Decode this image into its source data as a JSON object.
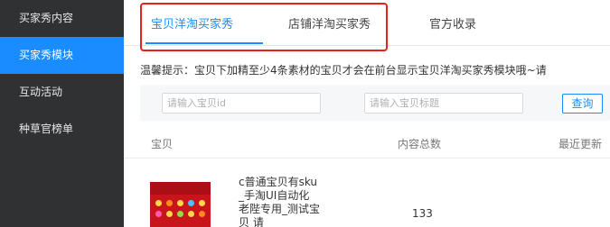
{
  "sidebar": {
    "items": [
      {
        "label": "买家秀内容",
        "active": false
      },
      {
        "label": "买家秀模块",
        "active": true
      },
      {
        "label": "互动活动",
        "active": false
      },
      {
        "label": "种草官榜单",
        "active": false
      }
    ]
  },
  "tabs": [
    {
      "label": "宝贝洋淘买家秀",
      "active": true
    },
    {
      "label": "店铺洋淘买家秀",
      "active": false
    },
    {
      "label": "官方收录",
      "active": false
    }
  ],
  "tip": "温馨提示：宝贝下加精至少4条素材的宝贝才会在前台显示宝贝洋淘买家秀模块哦~请",
  "filter": {
    "id_placeholder": "请输入宝贝id",
    "title_placeholder": "请输入宝贝标题",
    "search_label": "查询"
  },
  "table": {
    "headers": [
      "宝贝",
      "内容总数",
      "最近更新"
    ],
    "rows": [
      {
        "name": "c普通宝贝有sku_手淘UI自动化老陛专用_测试宝贝 请",
        "count": "133"
      }
    ]
  },
  "colors": {
    "sidebar_bg": "#2f3133",
    "accent": "#1a8cff",
    "highlight": "#e5211d"
  }
}
